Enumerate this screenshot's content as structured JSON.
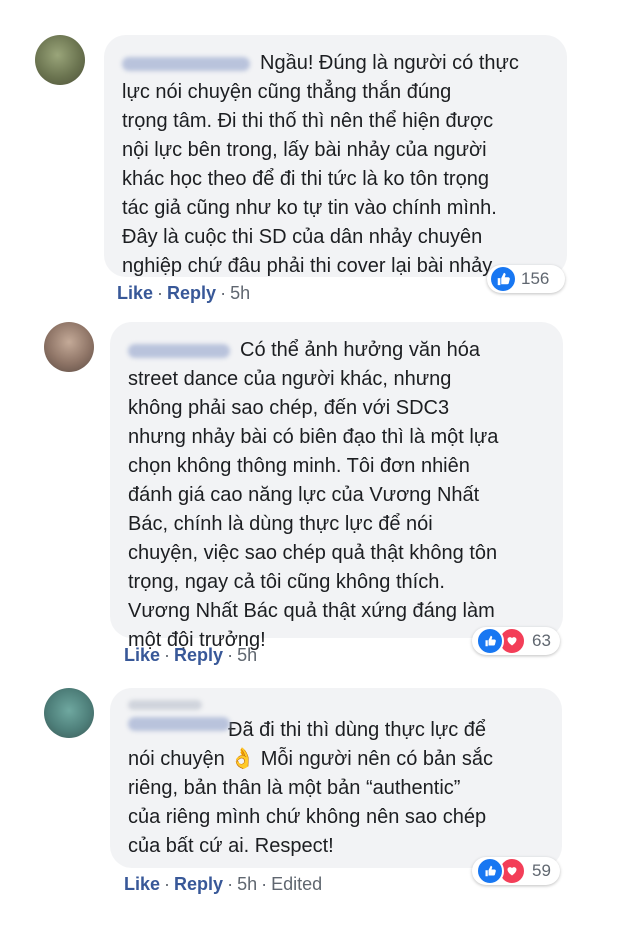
{
  "comments": [
    {
      "text": "Ngầu! Đúng là người có thực\nlực nói chuyện cũng thẳng thắn đúng\ntrọng tâm. Đi thi thố thì nên thể hiện được\nnội lực bên trong, lấy bài nhảy của người\nkhác học theo để đi thi tức là ko tôn trọng\ntác giả cũng như ko tự tin vào chính mình.\nĐây là cuộc thi SD của dân nhảy chuyên\nnghiệp chứ đâu phải thi cover lại bài nhảy",
      "reaction_count": "156",
      "reactions": [
        "like"
      ],
      "actions": {
        "like": "Like",
        "reply": "Reply",
        "time": "5h"
      }
    },
    {
      "text": "Có thể ảnh hưởng văn hóa\nstreet dance của người khác, nhưng\nkhông phải sao chép, đến với SDC3\nnhưng nhảy bài có biên đạo thì là một lựa\nchọn không thông minh. Tôi đơn nhiên\nđánh giá cao năng lực của Vương Nhất\nBác, chính là dùng thực lực để nói\nchuyện, việc sao chép quả thật không tôn\ntrọng, ngay cả tôi cũng không thích.\nVương Nhất Bác quả thật xứng đáng làm\nmột đội trưởng!",
      "reaction_count": "63",
      "reactions": [
        "like",
        "love"
      ],
      "actions": {
        "like": "Like",
        "reply": "Reply",
        "time": "5h"
      }
    },
    {
      "text": "Đã đi thi thì dùng thực lực để\nnói chuyện 👌 Mỗi người nên có bản sắc\nriêng, bản thân là một bản “authentic”\ncủa riêng mình chứ không nên sao chép\ncủa bất cứ ai. Respect!",
      "reaction_count": "59",
      "reactions": [
        "like",
        "love"
      ],
      "actions": {
        "like": "Like",
        "reply": "Reply",
        "time": "5h",
        "edited": "Edited"
      }
    }
  ],
  "colors": {
    "bubble": "#f2f3f5",
    "link": "#385898",
    "like_blue": "#1877f2",
    "love_red": "#f33e58",
    "meta_gray": "#606770"
  }
}
